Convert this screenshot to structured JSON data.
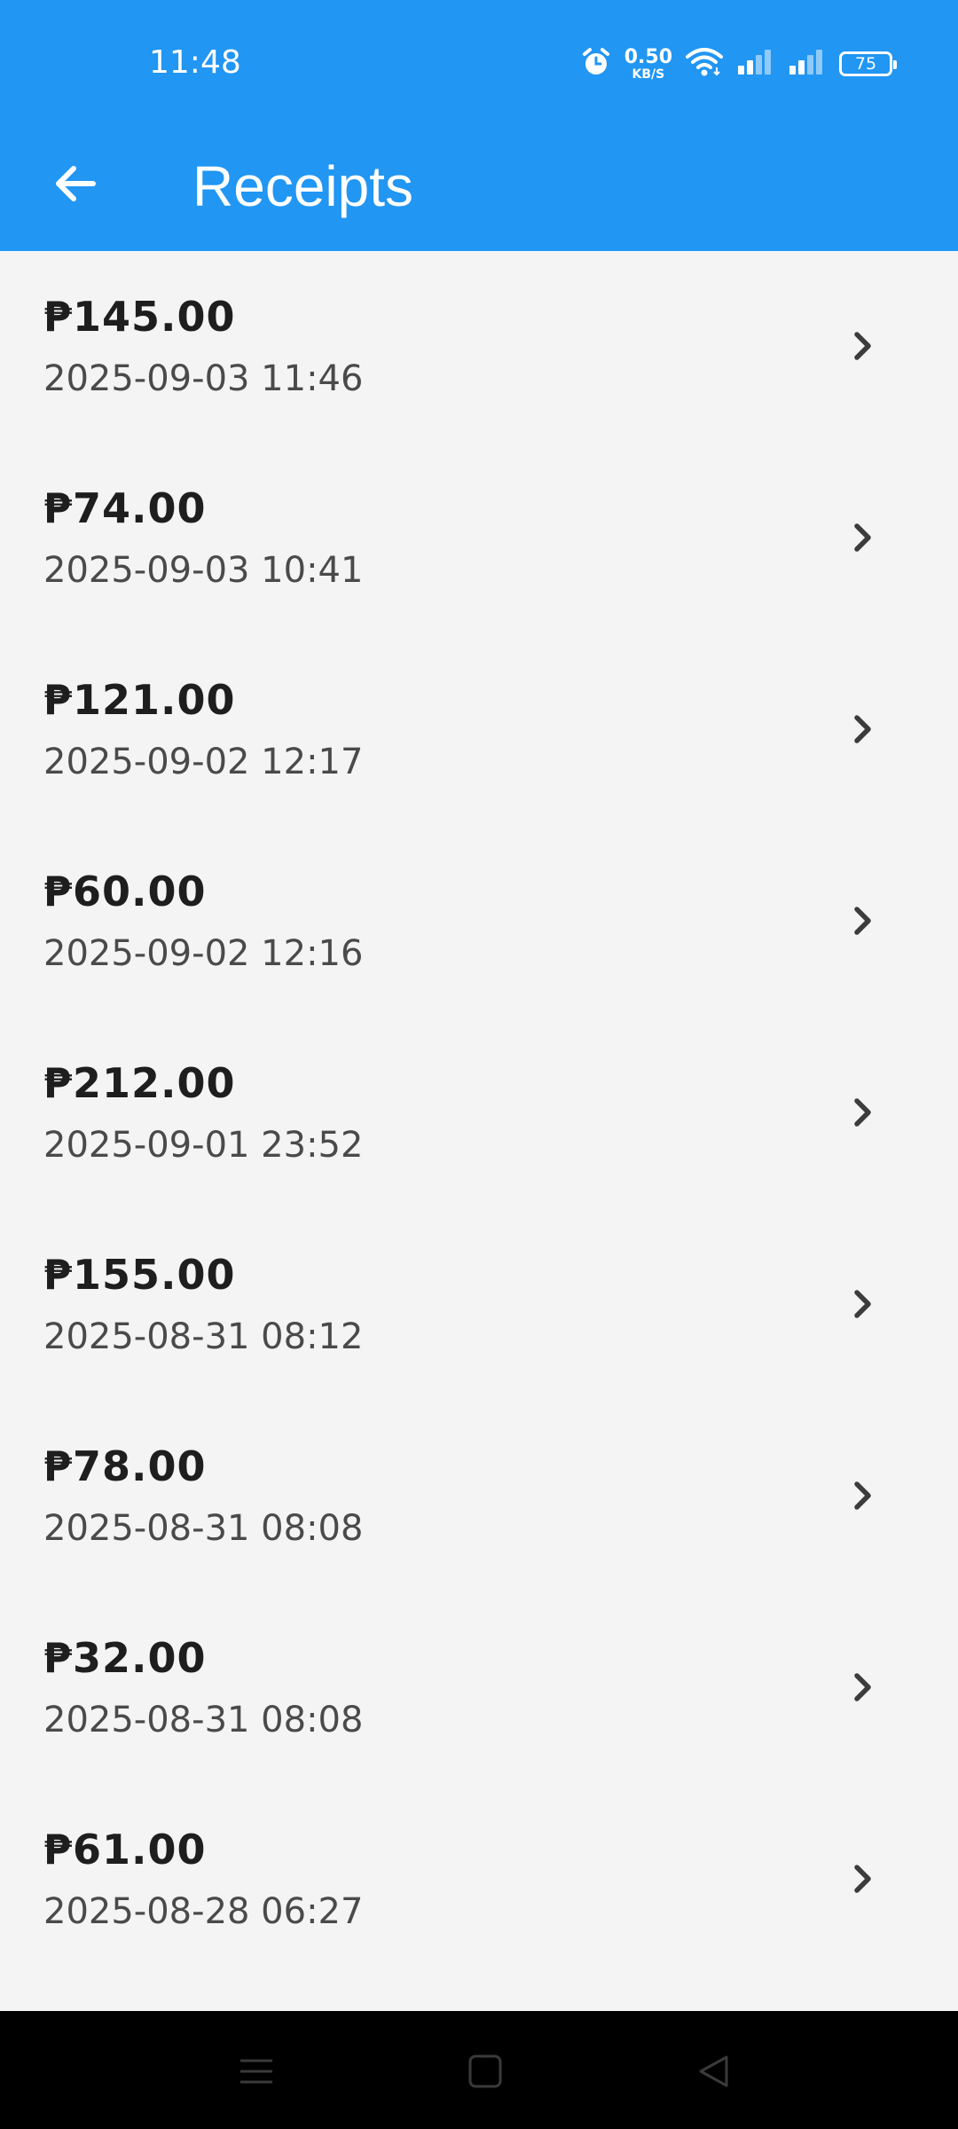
{
  "status_bar": {
    "time": "11:48",
    "net_speed_value": "0.50",
    "net_speed_unit": "KB/S",
    "battery": "75",
    "icons": [
      "alarm-icon",
      "wifi-icon",
      "signal-icon",
      "signal-icon"
    ]
  },
  "app_bar": {
    "title": "Receipts",
    "back_icon": "arrow-left-icon",
    "color": "#2196f3"
  },
  "receipts": [
    {
      "amount": "₱145.00",
      "date": "2025-09-03 11:46"
    },
    {
      "amount": "₱74.00",
      "date": "2025-09-03 10:41"
    },
    {
      "amount": "₱121.00",
      "date": "2025-09-02 12:17"
    },
    {
      "amount": "₱60.00",
      "date": "2025-09-02 12:16"
    },
    {
      "amount": "₱212.00",
      "date": "2025-09-01 23:52"
    },
    {
      "amount": "₱155.00",
      "date": "2025-08-31 08:12"
    },
    {
      "amount": "₱78.00",
      "date": "2025-08-31 08:08"
    },
    {
      "amount": "₱32.00",
      "date": "2025-08-31 08:08"
    },
    {
      "amount": "₱61.00",
      "date": "2025-08-28 06:27"
    }
  ],
  "nav_bar": {
    "icons": [
      "menu-icon",
      "home-icon",
      "back-icon"
    ]
  }
}
